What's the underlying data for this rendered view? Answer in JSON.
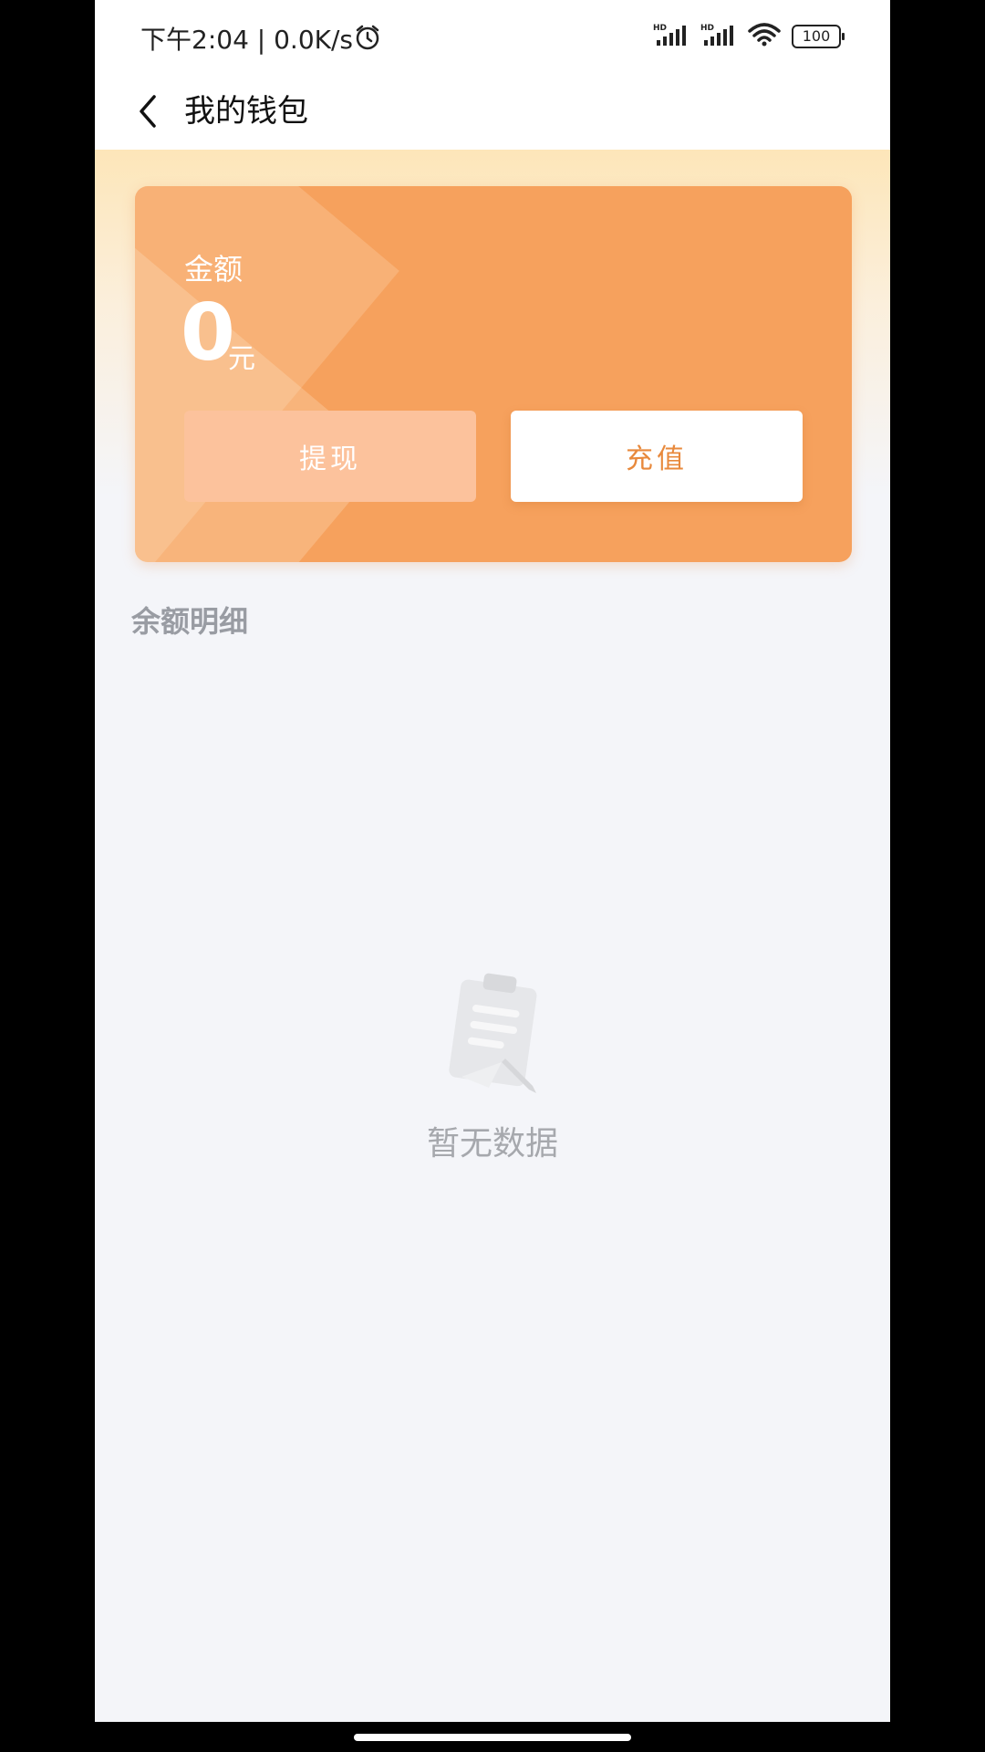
{
  "status_bar": {
    "time_speed": "下午2:04 | 0.0K/s",
    "battery": "100",
    "icons": [
      "alarm-icon",
      "signal-hd-icon",
      "signal-hd-icon",
      "wifi-icon",
      "battery-icon"
    ]
  },
  "nav": {
    "title": "我的钱包",
    "back_icon": "chevron-left-icon"
  },
  "wallet": {
    "amount_label": "金额",
    "amount_value": "0",
    "amount_unit": "元",
    "withdraw_label": "提现",
    "recharge_label": "充值",
    "colors": {
      "card": "#f6a15d",
      "withdraw_button": "#fcc29c",
      "recharge_text": "#e8893c"
    }
  },
  "balance_details": {
    "title": "余额明细",
    "empty_text": "暂无数据",
    "empty_icon": "clipboard-pen-icon"
  }
}
